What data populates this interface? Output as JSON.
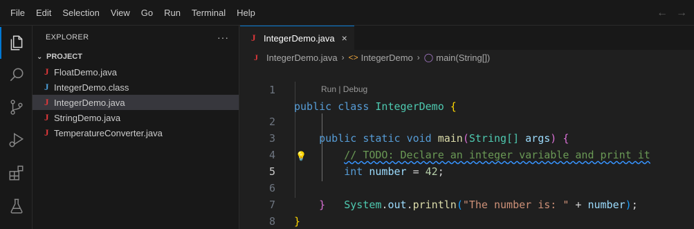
{
  "menu": [
    "File",
    "Edit",
    "Selection",
    "View",
    "Go",
    "Run",
    "Terminal",
    "Help"
  ],
  "activity_bar": [
    "explorer-icon",
    "search-icon",
    "source-control-icon",
    "run-debug-icon",
    "extensions-icon",
    "testing-icon"
  ],
  "explorer": {
    "title": "EXPLORER",
    "more": "···",
    "folder": "PROJECT",
    "files": [
      {
        "name": "FloatDemo.java",
        "icon": "J"
      },
      {
        "name": "IntegerDemo.class",
        "icon": "J"
      },
      {
        "name": "IntegerDemo.java",
        "icon": "J"
      },
      {
        "name": "StringDemo.java",
        "icon": "J"
      },
      {
        "name": "TemperatureConverter.java",
        "icon": "J"
      }
    ]
  },
  "tab": {
    "label": "IntegerDemo.java",
    "icon": "J",
    "close": "×"
  },
  "breadcrumb": {
    "file": "IntegerDemo.java",
    "class": "IntegerDemo",
    "method": "main(String[])"
  },
  "codelens": "Run | Debug",
  "line_numbers": [
    "1",
    "2",
    "3",
    "4",
    "5",
    "6",
    "7",
    "8"
  ],
  "code": {
    "l1": {
      "kw1": "public",
      "kw2": "class",
      "name": "IntegerDemo",
      "brace": "{"
    },
    "l2": {
      "kw1": "public",
      "kw2": "static",
      "kw3": "void",
      "fn": "main",
      "po": "(",
      "type": "String[]",
      "arg": "args",
      "pc": ")",
      "brace": "{"
    },
    "l3": {
      "comment": "// TODO: Declare an integer variable and print it"
    },
    "l4": {
      "type": "int",
      "var": "number",
      "eq": "=",
      "num": "42",
      "semi": ";"
    },
    "l5": {
      "obj": "System",
      "d1": ".",
      "field": "out",
      "d2": ".",
      "fn": "println",
      "po": "(",
      "str": "\"The number is: \"",
      "plus": "+",
      "var": "number",
      "pc": ")",
      "semi": ";"
    },
    "l6": {
      "brace": "}"
    },
    "l7": {
      "brace": "}"
    }
  },
  "colors": {
    "accent": "#0078d4",
    "java_icon": "#e2383b",
    "class_icon": "#4b9ed8"
  }
}
